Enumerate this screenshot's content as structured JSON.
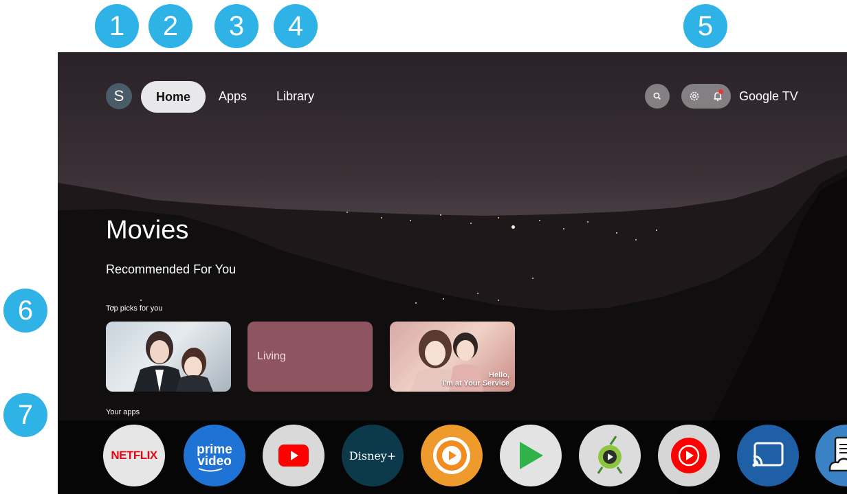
{
  "callouts": [
    "1",
    "2",
    "3",
    "4",
    "5",
    "6",
    "7"
  ],
  "header": {
    "avatar_initial": "S",
    "nav": [
      "Home",
      "Apps",
      "Library"
    ],
    "active_tab": "Home",
    "brand": "Google TV"
  },
  "icons": {
    "search": "search-icon",
    "settings": "gear-icon",
    "notifications": "bell-icon"
  },
  "hero": {
    "title": "Movies",
    "subtitle": "Recommended For You"
  },
  "rows": {
    "top_picks": {
      "label": "Top picks for you",
      "cards": [
        {
          "text": ""
        },
        {
          "text": "Living"
        },
        {
          "text_line1": "Hello,",
          "text_line2": "I'm at Your Service"
        }
      ]
    },
    "your_apps": {
      "label": "Your apps",
      "apps": [
        {
          "logo": "NETFLIX"
        },
        {
          "logo_line1": "prime",
          "logo_line2": "video"
        },
        {
          "icon": "youtube-icon"
        },
        {
          "logo": "Disney+"
        },
        {
          "icon": "player-icon"
        },
        {
          "icon": "play-store-icon"
        },
        {
          "icon": "media-player-icon"
        },
        {
          "icon": "youtube-music-icon"
        },
        {
          "icon": "cast-icon"
        },
        {
          "icon": "file-cloud-icon"
        }
      ]
    }
  },
  "colors": {
    "callout_badge": "#2fb3e6",
    "active_tab_bg": "#e8e8ea",
    "notification_dot": "#e53935",
    "netflix_red": "#e50914",
    "prime_blue": "#1f73d4",
    "dock_background": "rgba(0,0,0,0.55)"
  }
}
